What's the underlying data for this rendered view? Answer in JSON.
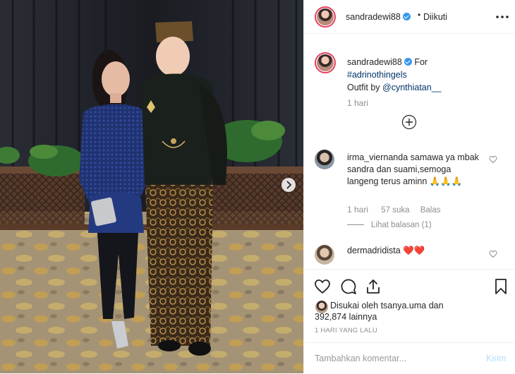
{
  "header": {
    "username": "sandradewi88",
    "separator": "•",
    "follow_status": "Diikuti"
  },
  "caption": {
    "username": "sandradewi88",
    "text_lead": "For",
    "hashtag": "#adrinothingels",
    "outfit_text": "Outfit by",
    "mention": "@cynthiatan__",
    "time": "1 hari"
  },
  "comments": [
    {
      "username": "irma_viernanda",
      "text": "samawa ya mbak sandra dan suami,semoga langeng terus aminn 🙏🙏🙏",
      "time": "1 hari",
      "likes": "57 suka",
      "reply_label": "Balas",
      "view_replies": "Lihat balasan (1)"
    },
    {
      "username": "dermadridista",
      "text": "❤️❤️"
    }
  ],
  "likes": {
    "prefix": "Disukai oleh",
    "user": "tsanya.uma",
    "conj": "dan",
    "count": "392,874",
    "suffix": "lainnya"
  },
  "date": "1 HARI YANG LALU",
  "add_comment": {
    "placeholder": "Tambahkan komentar...",
    "post_label": "Kirim"
  },
  "colors": {
    "accent_blue": "#3897f0",
    "link_dark_blue": "#003569",
    "post_disabled": "#b2dffc",
    "story_ring": "#e4405f",
    "muted": "#8e8e8e"
  },
  "icons": [
    "more-icon",
    "load-more-icon",
    "heart-icon",
    "comment-icon",
    "share-icon",
    "bookmark-icon",
    "chevron-right-icon",
    "verified-badge-icon"
  ]
}
